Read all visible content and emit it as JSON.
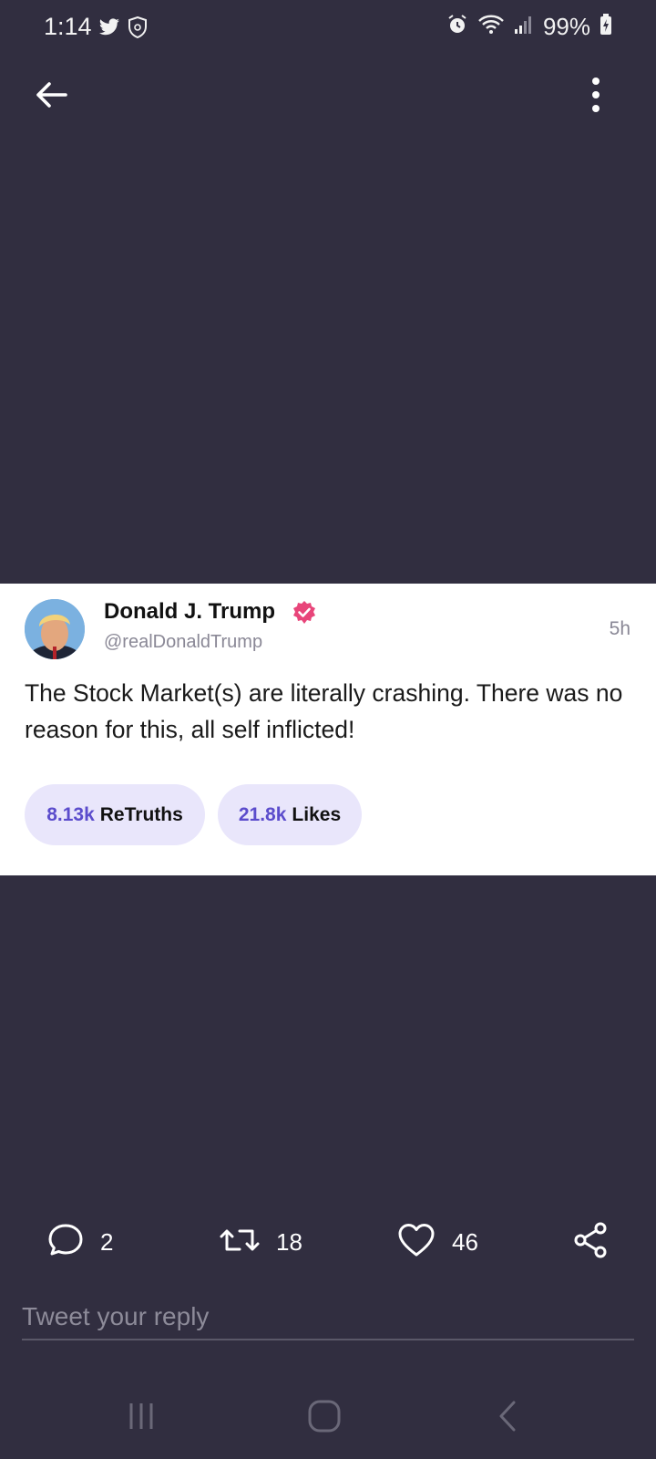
{
  "status_bar": {
    "time": "1:14",
    "icons_left": [
      "twitter-icon",
      "shield-icon"
    ],
    "icons_right": [
      "alarm-icon",
      "wifi-icon",
      "signal-icon",
      "battery-charging-icon"
    ],
    "battery": "99%"
  },
  "top_bar": {
    "back_icon": "arrow-left-icon",
    "menu_icon": "more-vertical-icon"
  },
  "post": {
    "author_name": "Donald J. Trump",
    "handle": "@realDonaldTrump",
    "time": "5h",
    "text": "The Stock Market(s) are literally crashing. There was no reason for this, all self inflicted!",
    "retruths_count": "8.13k",
    "retruths_label": "ReTruths",
    "likes_count": "21.8k",
    "likes_label": "Likes"
  },
  "actions": {
    "replies": "2",
    "retruths": "18",
    "likes": "46"
  },
  "reply_box": {
    "placeholder": "Tweet your reply"
  },
  "colors": {
    "background": "#312e40",
    "accent": "#5b4ccc",
    "pill_bg": "#e9e6fb",
    "verified": "#e8457a"
  }
}
